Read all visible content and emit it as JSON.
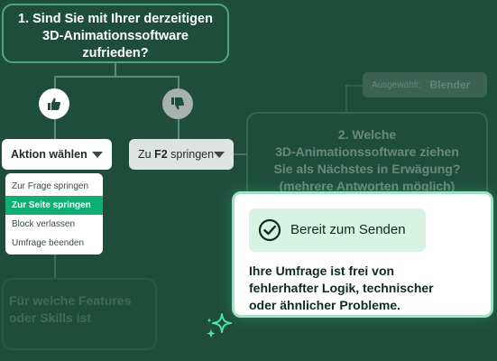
{
  "question1": {
    "line1": "1. Sind Sie mit Ihrer derzeitigen",
    "line2": "3D-Animationssoftware",
    "line3": "zufrieden?"
  },
  "question2": {
    "line1": "2. Welche",
    "line2": "3D-Animationssoftware ziehen",
    "line3": "Sie als Nächstes in Erwägung?",
    "line4": "(mehrere Antworten möglich)"
  },
  "question3": {
    "line1": "Für welche Features",
    "line2": "oder Skills ist"
  },
  "thumbs_up_icon": "thumbs-up-icon",
  "thumbs_down_icon": "thumbs-down-icon",
  "action_select": {
    "label": "Aktion wählen"
  },
  "jump_select": {
    "prefix": "Zu ",
    "target": "F2",
    "suffix": " springen"
  },
  "action_menu": [
    {
      "label": "Zur Frage springen",
      "active": false
    },
    {
      "label": "Zur Seite springen",
      "active": true
    },
    {
      "label": "Block verlassen",
      "active": false
    },
    {
      "label": "Umfrage beenden",
      "active": false
    }
  ],
  "selected_pill": {
    "label": "Ausgewählt:",
    "value": "Blender"
  },
  "ready_card": {
    "badge": "Bereit zum Senden",
    "line1": "Ihre Umfrage ist frei von",
    "line2": "fehlerhafter Logik, technischer",
    "line3": "oder ähnlicher Probleme."
  },
  "colors": {
    "background": "#1f4d3c",
    "accent": "#0fae72",
    "node_border": "#50a57f",
    "card_badge": "#d7f3e4"
  }
}
